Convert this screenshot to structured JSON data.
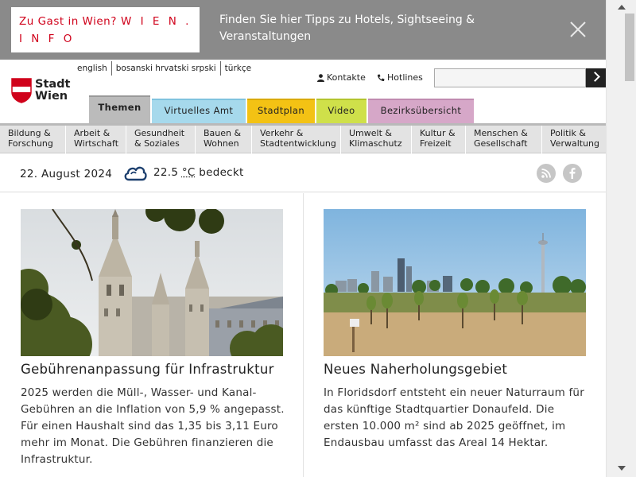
{
  "banner": {
    "box_line1": "Zu Gast in Wien?",
    "box_brand1": "W I E N .",
    "box_brand2": "I N F O",
    "text": "Finden Sie hier Tipps zu Hotels, Sightseeing & Veranstaltungen",
    "close_icon": "close-icon",
    "background": "#8a8a8a",
    "accent": "#d0021b"
  },
  "logo": {
    "line1": "Stadt",
    "line2": "Wien",
    "color": "#d0021b"
  },
  "languages": [
    "english",
    "bosanski hrvatski srpski",
    "türkçe"
  ],
  "top_links": {
    "kontakte": "Kontakte",
    "hotlines": "Hotlines"
  },
  "search": {
    "placeholder": ""
  },
  "tabs": [
    {
      "label": "Themen",
      "color": "#bbbbbb"
    },
    {
      "label": "Virtuelles Amt",
      "color": "#a6d9ec"
    },
    {
      "label": "Stadtplan",
      "color": "#f3c214"
    },
    {
      "label": "Video",
      "color": "#cfe04a"
    },
    {
      "label": "Bezirksübersicht",
      "color": "#d6a7c8"
    }
  ],
  "categories": [
    {
      "line1": "Bildung &",
      "line2": "Forschung"
    },
    {
      "line1": "Arbeit &",
      "line2": "Wirtschaft"
    },
    {
      "line1": "Gesundheit",
      "line2": "& Soziales"
    },
    {
      "line1": "Bauen &",
      "line2": "Wohnen"
    },
    {
      "line1": "Verkehr &",
      "line2": "Stadtentwicklung"
    },
    {
      "line1": "Umwelt &",
      "line2": "Klimaschutz"
    },
    {
      "line1": "Kultur &",
      "line2": "Freizeit"
    },
    {
      "line1": "Menschen &",
      "line2": "Gesellschaft"
    },
    {
      "line1": "Politik &",
      "line2": "Verwaltung"
    }
  ],
  "info": {
    "date": "22. August 2024",
    "temperature": "22.5",
    "unit": "°C",
    "condition": "bedeckt",
    "weather_icon": "cloud-icon"
  },
  "articles": [
    {
      "title": "Gebührenanpassung für Infrastruktur",
      "text": "2025 werden die Müll-, Wasser- und Kanal-Gebühren an die Inflation von 5,9 % angepasst. Für einen Haushalt sind das 1,35 bis 3,11 Euro mehr im Monat. Die Gebühren finanzieren die Infrastruktur."
    },
    {
      "title": "Neues Naherholungsgebiet",
      "text": "In Floridsdorf entsteht ein neuer Naturraum für das künftige Stadtquartier Donaufeld. Die ersten 10.000 m² sind ab 2025 geöffnet, im Endausbau umfasst das Areal 14 Hektar."
    }
  ]
}
